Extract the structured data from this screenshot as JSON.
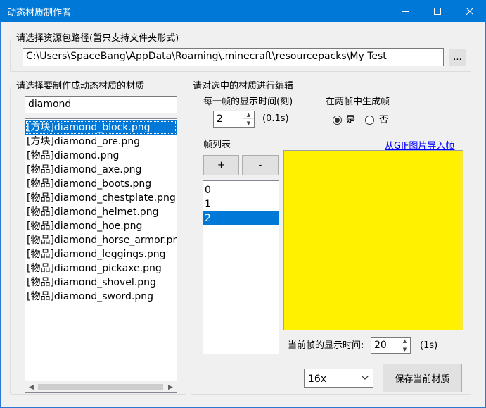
{
  "window": {
    "title": "动态材质制作者"
  },
  "resource_pack": {
    "group_label": "请选择资源包路径(暂只支持文件夹形式)",
    "path_value": "C:\\Users\\SpaceBang\\AppData\\Roaming\\.minecraft\\resourcepacks\\My Test",
    "browse_label": "..."
  },
  "texture_select": {
    "group_label": "请选择要制作成动态材质的材质",
    "filter_value": "diamond",
    "items": [
      "[方块]diamond_block.png",
      "[方块]diamond_ore.png",
      "[物品]diamond.png",
      "[物品]diamond_axe.png",
      "[物品]diamond_boots.png",
      "[物品]diamond_chestplate.png",
      "[物品]diamond_helmet.png",
      "[物品]diamond_hoe.png",
      "[物品]diamond_horse_armor.png",
      "[物品]diamond_leggings.png",
      "[物品]diamond_pickaxe.png",
      "[物品]diamond_shovel.png",
      "[物品]diamond_sword.png"
    ],
    "selected_index": 0
  },
  "editor": {
    "group_label": "请对选中的材质进行编辑",
    "frame_time_label": "每一帧的显示时间(刻)",
    "frame_time_value": "2",
    "frame_time_unit": "(0.1s)",
    "interpolate_label": "在两帧中生成帧",
    "radio_yes": "是",
    "radio_no": "否",
    "interpolate_selected": "yes",
    "frame_list_label": "帧列表",
    "add_label": "+",
    "remove_label": "-",
    "frames": [
      "0",
      "1",
      "2"
    ],
    "selected_frame": 2,
    "gif_import_label": "从GIF图片导入帧",
    "preview_color": "#fff100",
    "current_frame_time_label": "当前帧的显示时间:",
    "current_frame_time_value": "20",
    "current_frame_time_unit": "(1s)",
    "scale_value": "16x",
    "save_label": "保存当前材质"
  },
  "colors": {
    "titlebar": "#0078d7",
    "selection": "#0078d7",
    "link": "#0000ff"
  }
}
